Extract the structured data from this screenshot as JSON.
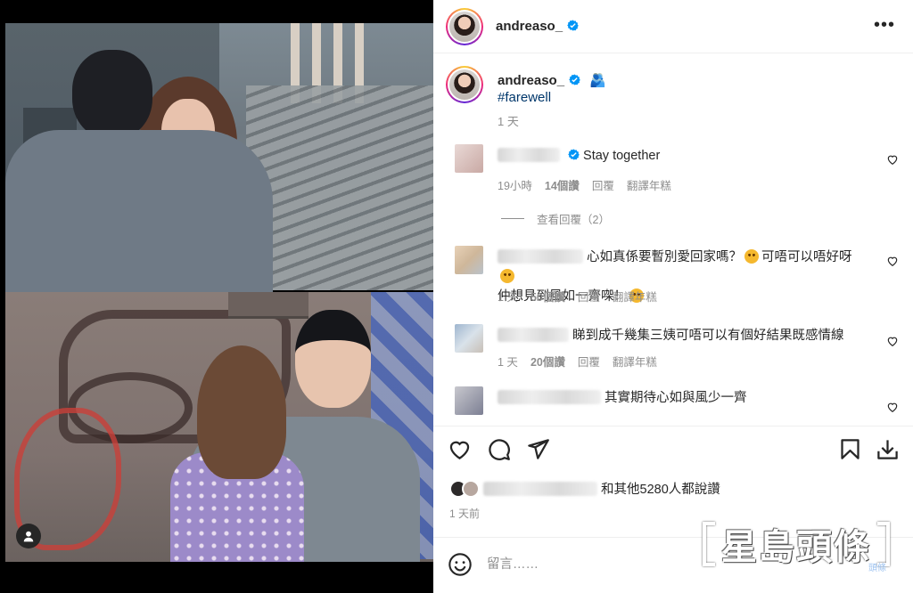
{
  "post": {
    "username": "andreaso_",
    "caption_text": "🫂",
    "hashtag": "#farewell",
    "caption_time": "1 天",
    "likes_text": "和其他5280人都說讚",
    "post_time": "1 天前"
  },
  "comments": [
    {
      "text": "Stay together",
      "time": "19小時",
      "likes": "14個讚",
      "reply": "回覆",
      "translate": "翻譯年糕",
      "view_replies": "查看回覆（2）"
    },
    {
      "text_1": "心如真係要暫別愛回家嗎？",
      "text_2": "可唔可以唔好呀",
      "text_3": "仲想見到風如一齊㗎！",
      "time": "1 天",
      "likes": "50個讚",
      "reply": "回覆",
      "translate": "翻譯年糕"
    },
    {
      "text": "睇到成千幾集三姨可唔可以有個好結果既感情線",
      "time": "1 天",
      "likes": "20個讚",
      "reply": "回覆",
      "translate": "翻譯年糕"
    },
    {
      "text": "其實期待心如與風少一齊"
    }
  ],
  "add_comment_placeholder": "留言……",
  "watermark": {
    "text": "星島頭條",
    "small": "頭條"
  },
  "icons": {
    "more": "more-options-icon",
    "verified": "verified-badge-icon",
    "heart": "heart-icon",
    "comment": "comment-icon",
    "share": "share-icon",
    "save": "bookmark-icon",
    "download": "download-icon",
    "emoji": "emoji-icon",
    "tag": "user-tag-icon"
  },
  "colors": {
    "link": "#00376b",
    "verified": "#0095f6",
    "secondary_text": "#8e8e8e"
  }
}
